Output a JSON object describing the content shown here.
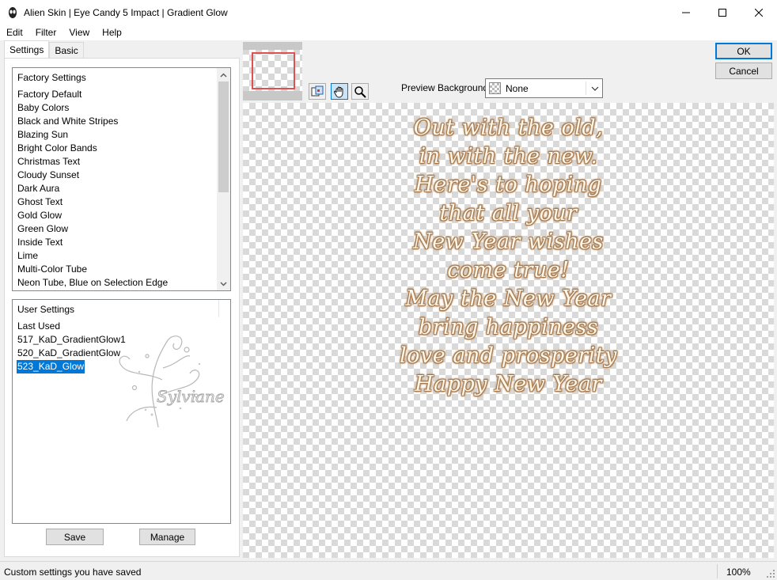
{
  "window": {
    "title": "Alien Skin | Eye Candy 5 Impact | Gradient Glow"
  },
  "menu": {
    "items": [
      {
        "label": "Edit"
      },
      {
        "label": "Filter"
      },
      {
        "label": "View"
      },
      {
        "label": "Help"
      }
    ]
  },
  "tabs": [
    {
      "label": "Settings",
      "active": true
    },
    {
      "label": "Basic",
      "active": false
    }
  ],
  "factory_settings": {
    "header": "Factory Settings",
    "items": [
      "Factory Default",
      "Baby Colors",
      "Black and White Stripes",
      "Blazing Sun",
      "Bright Color Bands",
      "Christmas Text",
      "Cloudy Sunset",
      "Dark Aura",
      "Ghost Text",
      "Gold Glow",
      "Green Glow",
      "Inside Text",
      "Lime",
      "Multi-Color Tube",
      "Neon Tube, Blue on Selection Edge"
    ]
  },
  "user_settings": {
    "header": "User Settings",
    "items": [
      {
        "label": "Last Used",
        "selected": false
      },
      {
        "label": "517_KaD_GradientGlow1",
        "selected": false
      },
      {
        "label": "520_KaD_GradientGlow",
        "selected": false
      },
      {
        "label": "523_KaD_Glow",
        "selected": true
      }
    ]
  },
  "buttons": {
    "save": "Save",
    "manage": "Manage",
    "ok": "OK",
    "cancel": "Cancel"
  },
  "preview": {
    "background_label": "Preview Background:",
    "background_value": "None",
    "poem_lines": [
      "Out with the old,",
      "in with the new.",
      "Here's to hoping",
      "that all your",
      "New Year wishes",
      "come true!",
      "May the New Year",
      "bring happiness",
      "love and prosperity",
      "Happy New Year"
    ],
    "text_color": "#fff7ea",
    "glow_color": "#a87a4c"
  },
  "watermark": {
    "text": "Sylviane"
  },
  "status": {
    "message": "Custom settings you have saved",
    "zoom": "100%"
  },
  "colors": {
    "selection": "#0078d7",
    "thumb_frame": "#e05050"
  }
}
